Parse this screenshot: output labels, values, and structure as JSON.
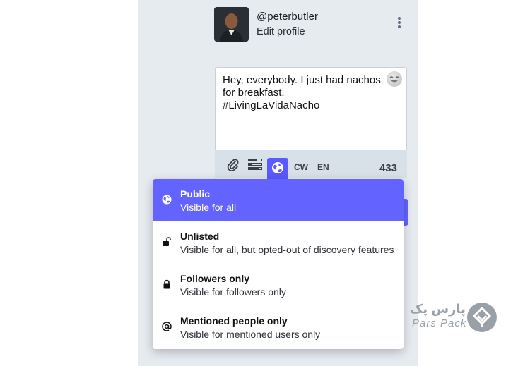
{
  "profile": {
    "username": "@peterbutler",
    "edit_label": "Edit profile"
  },
  "compose": {
    "text": "Hey, everybody. I just had nachos\nfor breakfast.\n#LivingLaVidaNacho",
    "emoji_icon": "emoji-icon"
  },
  "toolbar": {
    "attach_icon": "paperclip-icon",
    "poll_icon": "poll-icon",
    "visibility_icon": "globe-icon",
    "cw_label": "CW",
    "language_label": "EN",
    "char_count": "433"
  },
  "visibility_menu": {
    "options": [
      {
        "title": "Public",
        "description": "Visible for all",
        "icon": "globe-icon",
        "selected": true
      },
      {
        "title": "Unlisted",
        "description": "Visible for all, but opted-out of discovery features",
        "icon": "unlock-icon",
        "selected": false
      },
      {
        "title": "Followers only",
        "description": "Visible for followers only",
        "icon": "lock-icon",
        "selected": false
      },
      {
        "title": "Mentioned people only",
        "description": "Visible for mentioned users only",
        "icon": "at-icon",
        "selected": false
      }
    ]
  },
  "watermark": {
    "persian": "پارس پک",
    "latin": "Pars Pack"
  },
  "colors": {
    "accent": "#6364ff",
    "panel_bg": "#e6ebf0"
  }
}
